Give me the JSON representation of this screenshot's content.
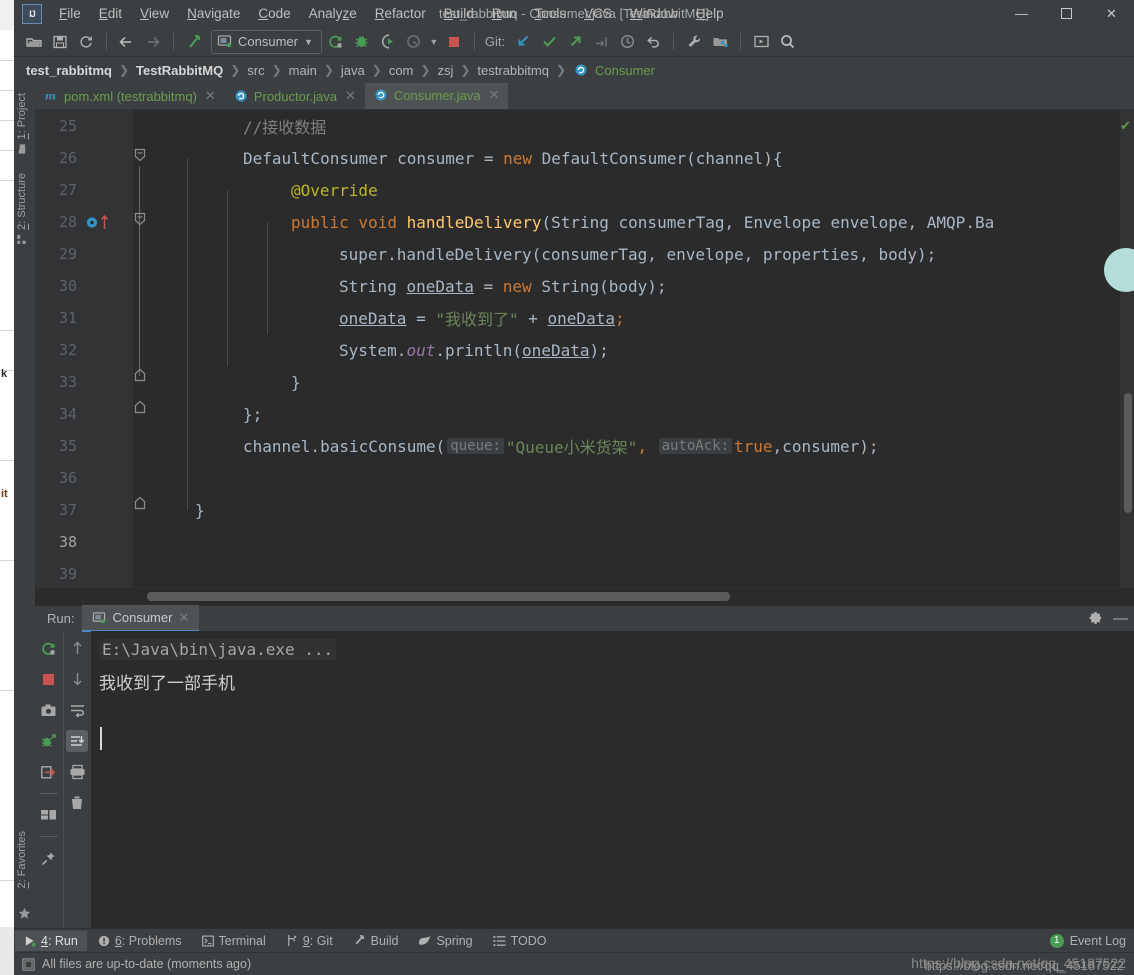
{
  "window": {
    "title": "test_rabbitmq - Consumer.java [TestRabbitMQ]",
    "logo_text": "IJ",
    "minimize": "—",
    "maximize": "❐",
    "close": "✕"
  },
  "menu": {
    "items": [
      {
        "label": "File",
        "mnemonic": "F"
      },
      {
        "label": "Edit",
        "mnemonic": "E"
      },
      {
        "label": "View",
        "mnemonic": "V"
      },
      {
        "label": "Navigate",
        "mnemonic": "N"
      },
      {
        "label": "Code",
        "mnemonic": "C"
      },
      {
        "label": "Analyze",
        "mnemonic": "A"
      },
      {
        "label": "Refactor",
        "mnemonic": "R"
      },
      {
        "label": "Build",
        "mnemonic": "B"
      },
      {
        "label": "Run",
        "mnemonic": "R"
      },
      {
        "label": "Tools",
        "mnemonic": "T"
      },
      {
        "label": "VCS",
        "mnemonic": "V"
      },
      {
        "label": "Window",
        "mnemonic": "W"
      },
      {
        "label": "Help",
        "mnemonic": "H"
      }
    ]
  },
  "toolbar": {
    "run_config_name": "Consumer",
    "git_label": "Git:",
    "icons": [
      "open-folder-icon",
      "save-all-icon",
      "sync-icon",
      "back-arrow-icon",
      "forward-arrow-icon",
      "build-hammer-icon",
      "run-icon",
      "debug-icon",
      "run-with-coverage-icon",
      "profile-icon",
      "stop-icon",
      "update-project-icon",
      "commit-icon",
      "push-icon",
      "revert-icon",
      "history-icon",
      "undo-icon",
      "settings-wrench-icon",
      "project-structure-icon",
      "run-anything-icon",
      "search-everywhere-icon"
    ]
  },
  "breadcrumb": {
    "items": [
      {
        "label": "test_rabbitmq",
        "bold": true
      },
      {
        "label": "TestRabbitMQ",
        "bold": true
      },
      {
        "label": "src",
        "bold": false
      },
      {
        "label": "main",
        "bold": false
      },
      {
        "label": "java",
        "bold": false
      },
      {
        "label": "com",
        "bold": false
      },
      {
        "label": "zsj",
        "bold": false
      },
      {
        "label": "testrabbitmq",
        "bold": false
      },
      {
        "label": "Consumer",
        "bold": false,
        "green": true
      }
    ],
    "separator": "❯"
  },
  "left_strip": {
    "top_items": [
      {
        "label": "1: Project",
        "mnemonic": "1",
        "icon": "project-folder-icon"
      },
      {
        "label": "2: Structure",
        "mnemonic": "2",
        "icon": "structure-icon"
      }
    ],
    "bottom_items": [
      {
        "label": "2: Favorites",
        "mnemonic": "2",
        "icon": "star-icon"
      }
    ]
  },
  "editor_tabs": [
    {
      "label": "pom.xml (testrabbitmq)",
      "icon": "maven-icon",
      "active": false,
      "close": "✕"
    },
    {
      "label": "Productor.java",
      "icon": "java-class-icon",
      "active": false,
      "close": "✕"
    },
    {
      "label": "Consumer.java",
      "icon": "java-class-icon",
      "active": true,
      "close": "✕"
    }
  ],
  "editor": {
    "first_line_number": 25,
    "lines": [
      {
        "n": 25,
        "indent": 0
      },
      {
        "n": 26,
        "indent": 0,
        "fold": "collapse"
      },
      {
        "n": 27,
        "indent": 0
      },
      {
        "n": 28,
        "indent": 0,
        "fold": "collapse",
        "marker": "override-implements-icon"
      },
      {
        "n": 29,
        "indent": 0
      },
      {
        "n": 30,
        "indent": 0
      },
      {
        "n": 31,
        "indent": 0
      },
      {
        "n": 32,
        "indent": 0
      },
      {
        "n": 33,
        "indent": 0,
        "fold": "end"
      },
      {
        "n": 34,
        "indent": 0,
        "fold": "end"
      },
      {
        "n": 35,
        "indent": 0
      },
      {
        "n": 36,
        "indent": 0
      },
      {
        "n": 37,
        "indent": 0,
        "fold": "end"
      },
      {
        "n": 38,
        "indent": 0
      },
      {
        "n": 39,
        "indent": 0
      }
    ],
    "code": {
      "l25": "//接收数据",
      "l26_a": "DefaultConsumer consumer = ",
      "l26_kw": "new",
      "l26_b": " DefaultConsumer(channel){",
      "l27": "@Override",
      "l28_kw": "public void",
      "l28_fn": " handleDelivery",
      "l28_rest": "(String consumerTag, Envelope envelope, AMQP.Ba",
      "l29": "super.handleDelivery(consumerTag, envelope, properties, body);",
      "l30_a": "String ",
      "l30_var": "oneData",
      "l30_eq": " = ",
      "l30_kw": "new",
      "l30_b": " String(body);",
      "l31_var": "oneData",
      "l31_eq": " = ",
      "l31_str": "\"我收到了\"",
      "l31_plus": " + ",
      "l31_var2": "oneData",
      "l31_end": ";",
      "l32_a": "System.",
      "l32_fld": "out",
      "l32_b": ".println(",
      "l32_var": "oneData",
      "l32_c": ");",
      "l33": "}",
      "l34": "};",
      "l35_a": "channel.basicConsume(",
      "l35_hint1": "queue:",
      "l35_str": "\"Queue小米货架\"",
      "l35_comma": ", ",
      "l35_hint2": "autoAck:",
      "l35_true": "true",
      "l35_rest": ",consumer);",
      "l37": "}"
    },
    "inspection_status": "✔"
  },
  "run_window": {
    "label": "Run:",
    "tab_label": "Consumer",
    "tab_close": "✕",
    "tab_icon": "run-config-icon",
    "settings_icon": "gear-icon",
    "hide_icon": "minimize-icon",
    "toolbar_left": [
      "rerun-icon",
      "stop-icon",
      "screenshot-icon",
      "attach-debugger-icon",
      "export-icon",
      "layout-icon",
      "pin-icon"
    ],
    "toolbar_right": [
      "up-arrow-icon",
      "down-arrow-icon",
      "soft-wrap-icon",
      "scroll-to-end-icon",
      "print-icon",
      "trash-icon"
    ],
    "console": {
      "command": "E:\\Java\\bin\\java.exe ...",
      "output_line": "我收到了一部手机"
    }
  },
  "bottom_strip": {
    "items": [
      {
        "label": "4: Run",
        "mnemonic": "4",
        "icon": "run-icon",
        "active": true
      },
      {
        "label": "6: Problems",
        "mnemonic": "6",
        "icon": "problems-icon",
        "active": false
      },
      {
        "label": "Terminal",
        "mnemonic": "",
        "icon": "terminal-icon",
        "active": false
      },
      {
        "label": "9: Git",
        "mnemonic": "9",
        "icon": "git-branch-icon",
        "active": false
      },
      {
        "label": "Build",
        "mnemonic": "",
        "icon": "build-hammer-icon",
        "active": false
      },
      {
        "label": "Spring",
        "mnemonic": "",
        "icon": "spring-leaf-icon",
        "active": false
      },
      {
        "label": "TODO",
        "mnemonic": "",
        "icon": "todo-list-icon",
        "active": false
      }
    ],
    "event_log": {
      "label": "Event Log",
      "count": "1"
    }
  },
  "status_bar": {
    "message": "All files are up-to-date (moments ago)",
    "icon": "document-icon",
    "watermark_front": "https://blog.csdn.net/qq_45187522",
    "watermark_back": "https://blog.csdn.net/qq_45187522"
  },
  "colors": {
    "ide_bg": "#3c3f41",
    "editor_bg": "#2b2b2b",
    "gutter_bg": "#313335",
    "accent_blue": "#4a88c7",
    "keyword_orange": "#cc7832",
    "string_green": "#6a8759",
    "method_yellow": "#ffc66d",
    "annotation_olive": "#bbb529",
    "identifier": "#a9b7c6",
    "comment_gray": "#808080",
    "field_purple": "#9876aa",
    "green_ok": "#499c54"
  }
}
